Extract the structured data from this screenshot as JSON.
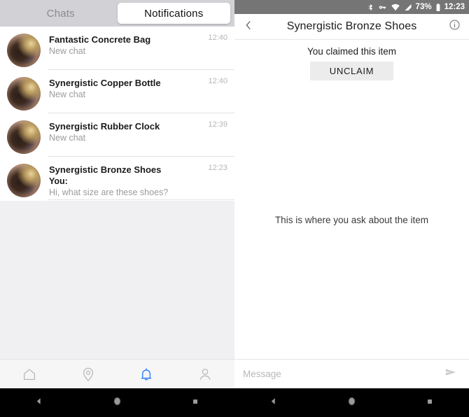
{
  "left_panel": {
    "tabs": [
      {
        "label": "Chats",
        "selected": false
      },
      {
        "label": "Notifications",
        "selected": true
      }
    ],
    "chats": [
      {
        "title": "Fantastic Concrete Bag",
        "preview": "New chat",
        "sender": "",
        "time": "12:40"
      },
      {
        "title": "Synergistic Copper Bottle",
        "preview": "New chat",
        "sender": "",
        "time": "12:40"
      },
      {
        "title": "Synergistic Rubber Clock",
        "preview": "New chat",
        "sender": "",
        "time": "12:39"
      },
      {
        "title": "Synergistic Bronze Shoes",
        "preview": "Hi, what size are these shoes?",
        "sender": "You:",
        "time": "12:23"
      }
    ],
    "bottom_nav": [
      {
        "icon": "home-icon",
        "active": false
      },
      {
        "icon": "location-pin-icon",
        "active": false
      },
      {
        "icon": "bell-icon",
        "active": true
      },
      {
        "icon": "person-icon",
        "active": false
      }
    ],
    "active_nav_color": "#2e7dfa"
  },
  "right_panel": {
    "status_bar": {
      "battery_percent": "73%",
      "time": "12:23",
      "icons": [
        "bluetooth-icon",
        "vpn-key-icon",
        "wifi-icon",
        "cell-signal-icon",
        "battery-icon"
      ]
    },
    "header": {
      "back_icon": "chevron-left-icon",
      "title": "Synergistic Bronze Shoes",
      "info_icon": "info-circle-icon"
    },
    "claim": {
      "status_text": "You claimed this item",
      "button_label": "UNCLAIM"
    },
    "messages": {
      "empty_text": "This is where you ask about the item"
    },
    "composer": {
      "placeholder": "Message",
      "value": "",
      "send_icon": "send-icon"
    }
  },
  "system_nav": {
    "buttons": [
      "back-triangle-icon",
      "home-circle-icon",
      "recents-square-icon"
    ]
  }
}
